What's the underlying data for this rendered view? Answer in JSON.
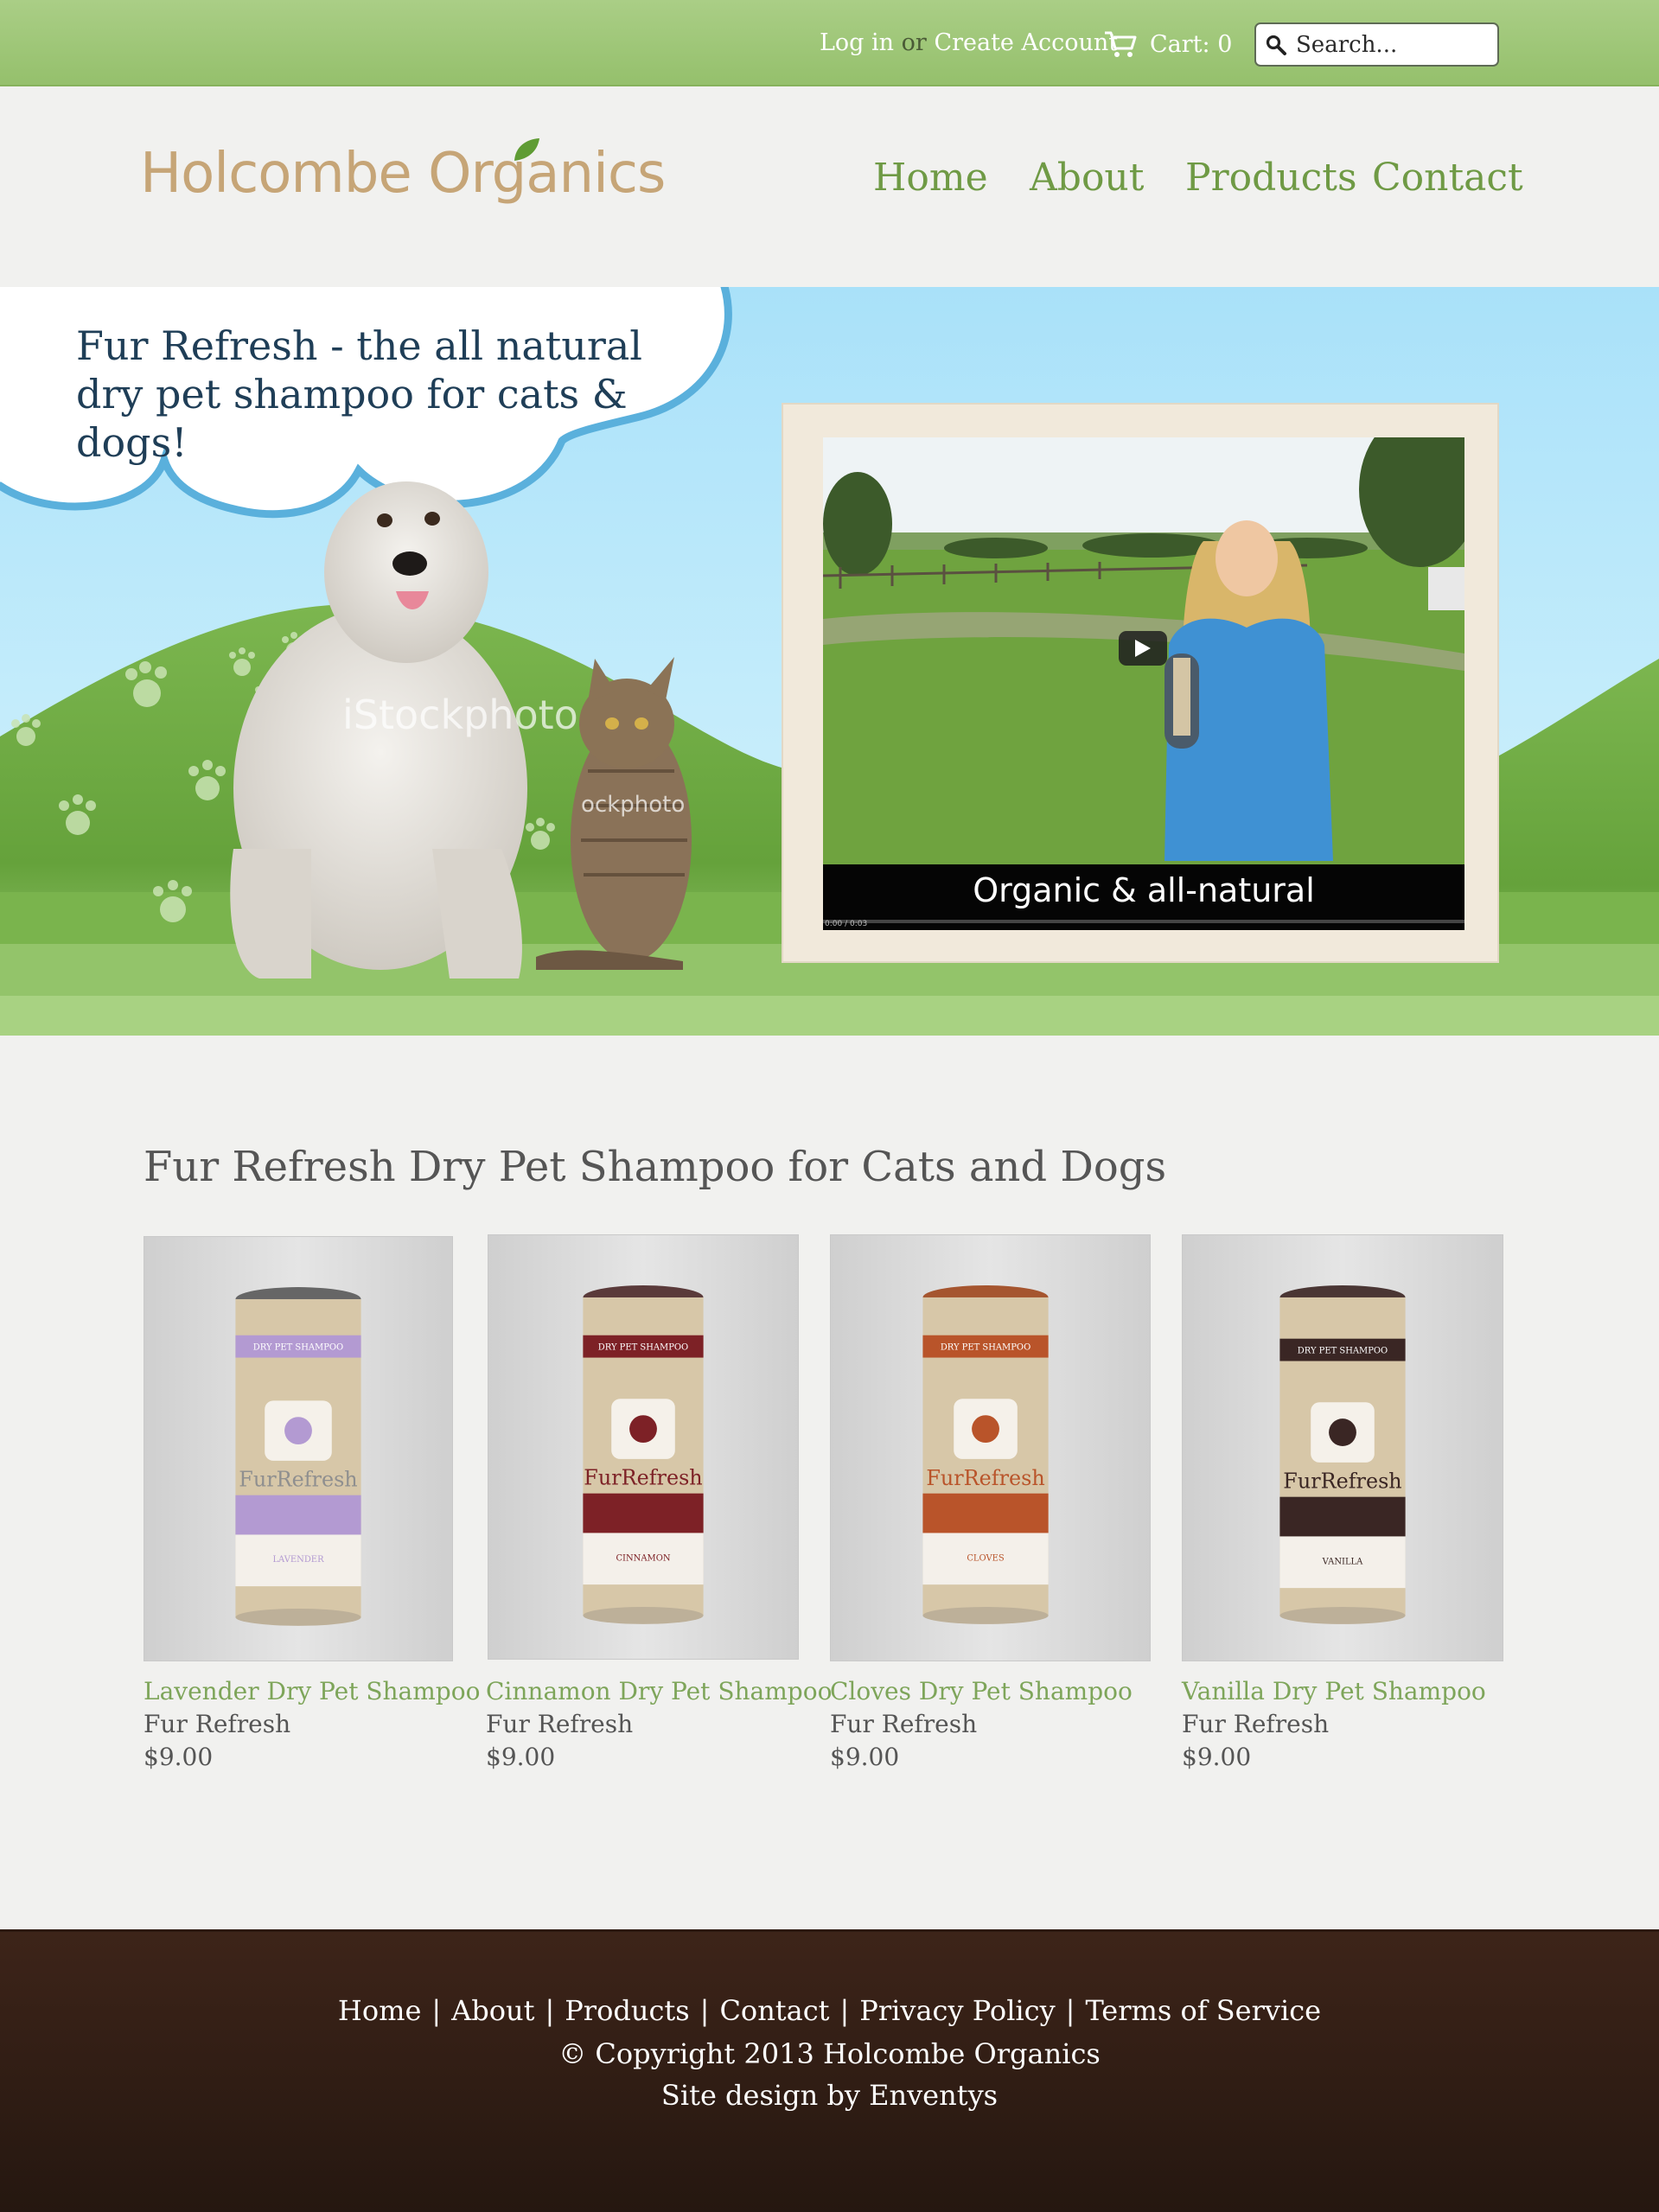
{
  "topbar": {
    "login": "Log in",
    "or": "or",
    "create_account": "Create Account",
    "cart": "Cart: 0",
    "search_placeholder": "Search..."
  },
  "header": {
    "logo_text": "Holcombe Organics",
    "nav": [
      {
        "label": "Home"
      },
      {
        "label": "About"
      },
      {
        "label": "Products"
      },
      {
        "label": "Contact"
      }
    ]
  },
  "hero": {
    "tagline": "Fur Refresh - the all natural dry pet shampoo for cats & dogs!",
    "watermark": "iStockphoto",
    "watermark_small": "ockphoto",
    "video": {
      "caption": "Organic & all-natural",
      "time": "0:00 / 0:03"
    }
  },
  "products_section": {
    "title": "Fur Refresh Dry Pet Shampoo for Cats and Dogs",
    "items": [
      {
        "name": "Lavender Dry Pet Shampoo",
        "vendor": "Fur Refresh",
        "price": "$9.00",
        "label_color": "#b39ad2",
        "band_text": "DRY PET SHAMPOO",
        "scent": "LAVENDER"
      },
      {
        "name": "Cinnamon Dry Pet Shampoo",
        "vendor": "Fur Refresh",
        "price": "$9.00",
        "label_color": "#7d2126",
        "band_text": "DRY PET SHAMPOO",
        "scent": "CINNAMON"
      },
      {
        "name": "Cloves Dry Pet Shampoo",
        "vendor": "Fur Refresh",
        "price": "$9.00",
        "label_color": "#b9542a",
        "band_text": "DRY PET SHAMPOO",
        "scent": "CLOVES"
      },
      {
        "name": "Vanilla Dry Pet Shampoo",
        "vendor": "Fur Refresh",
        "price": "$9.00",
        "label_color": "#3a2624",
        "band_text": "DRY PET SHAMPOO",
        "scent": "VANILLA"
      }
    ]
  },
  "footer": {
    "links": [
      {
        "label": "Home"
      },
      {
        "label": "About"
      },
      {
        "label": "Products"
      },
      {
        "label": "Contact"
      },
      {
        "label": "Privacy Policy"
      },
      {
        "label": "Terms of Service"
      }
    ],
    "copyright": "© Copyright 2013 Holcombe Organics",
    "credit": "Site design by Enventys"
  }
}
